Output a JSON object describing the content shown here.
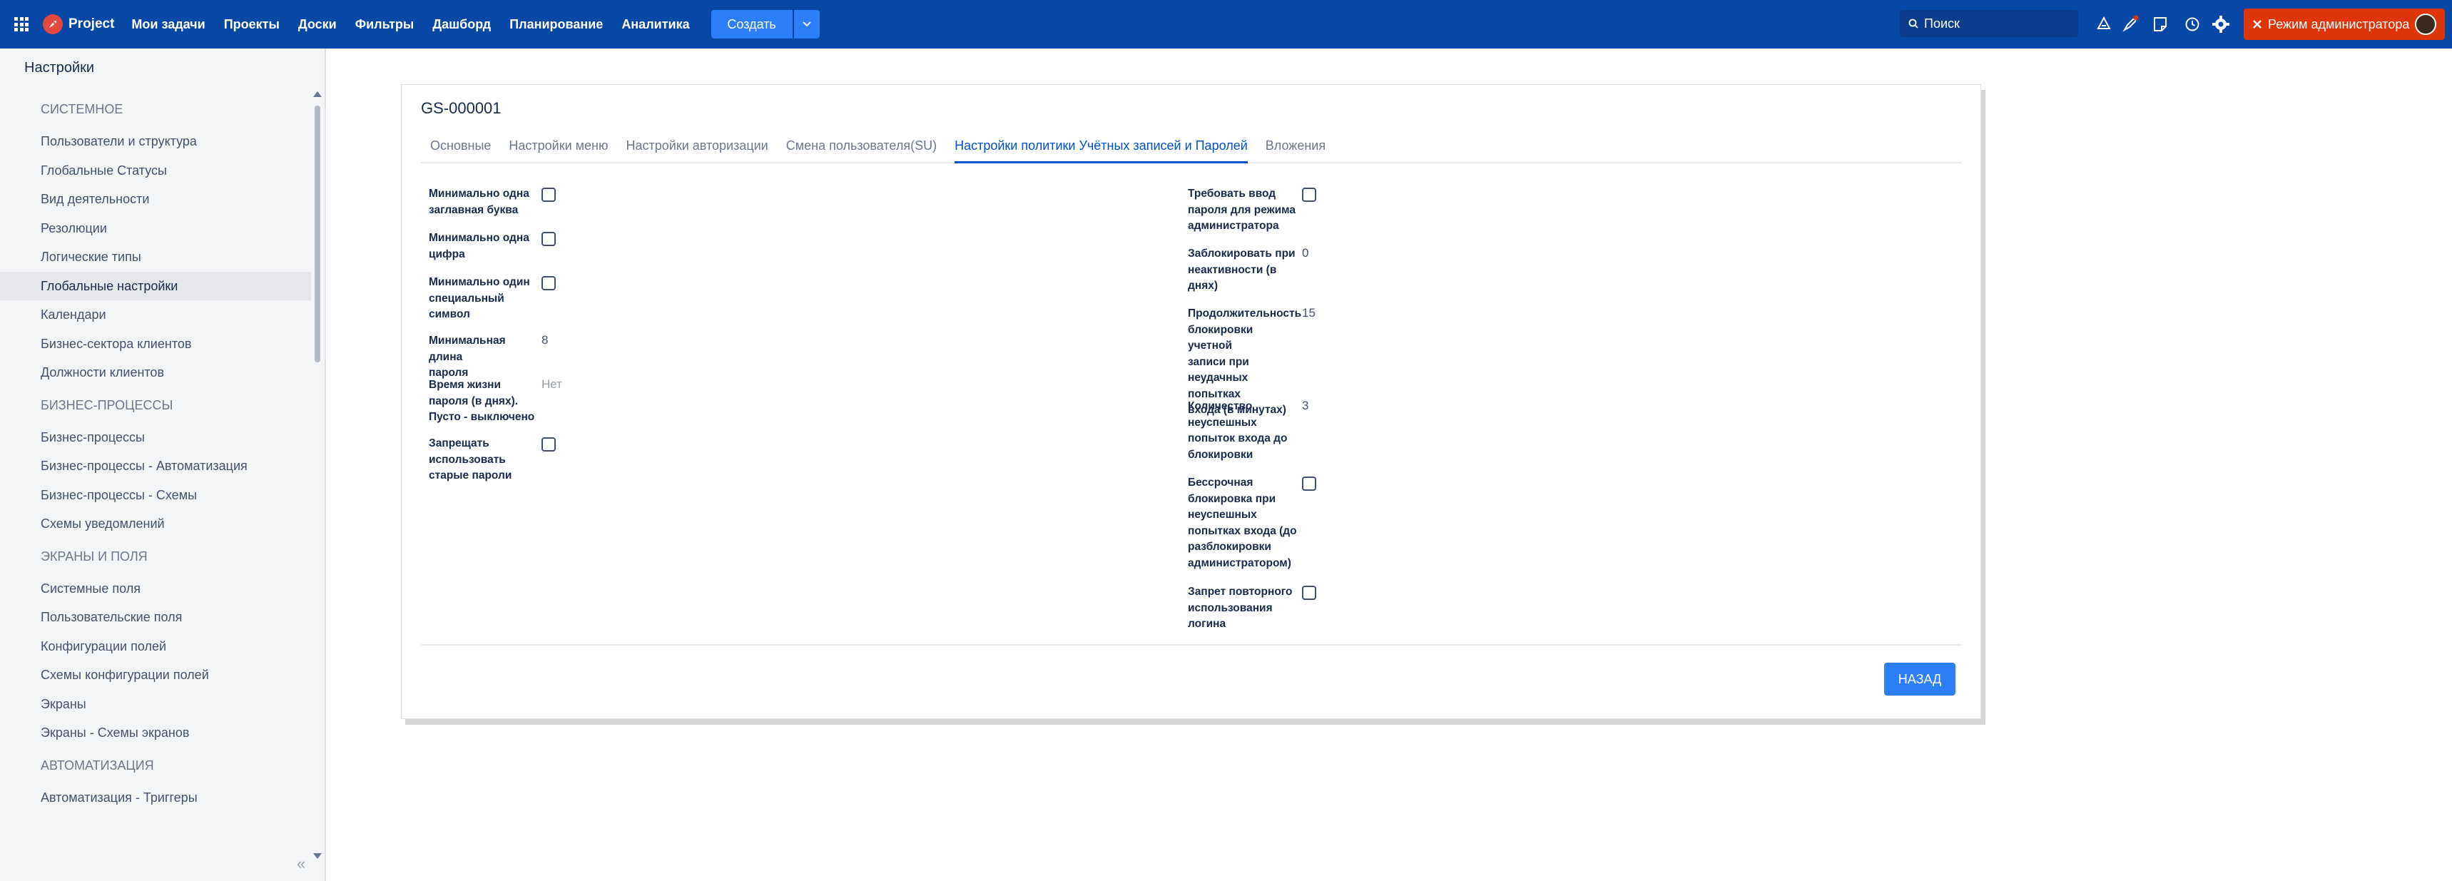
{
  "header": {
    "app_name": "Project",
    "nav": [
      "Мои задачи",
      "Проекты",
      "Доски",
      "Фильтры",
      "Дашборд",
      "Планирование",
      "Аналитика"
    ],
    "create_label": "Создать",
    "search_placeholder": "Поиск",
    "admin_label": "Режим администратора"
  },
  "sidebar": {
    "title": "Настройки",
    "entries": [
      {
        "type": "section",
        "label": "СИСТЕМНОЕ"
      },
      {
        "type": "item",
        "label": "Пользователи и структура"
      },
      {
        "type": "item",
        "label": "Глобальные Статусы"
      },
      {
        "type": "item",
        "label": "Вид деятельности"
      },
      {
        "type": "item",
        "label": "Резолюции"
      },
      {
        "type": "item",
        "label": "Логические типы"
      },
      {
        "type": "item",
        "label": "Глобальные настройки",
        "active": true
      },
      {
        "type": "item",
        "label": "Календари"
      },
      {
        "type": "item",
        "label": "Бизнес-сектора клиентов"
      },
      {
        "type": "item",
        "label": "Должности клиентов"
      },
      {
        "type": "section",
        "label": "БИЗНЕС-ПРОЦЕССЫ"
      },
      {
        "type": "item",
        "label": "Бизнес-процессы"
      },
      {
        "type": "item",
        "label": "Бизнес-процессы - Автоматизация"
      },
      {
        "type": "item",
        "label": "Бизнес-процессы - Схемы"
      },
      {
        "type": "item",
        "label": "Схемы уведомлений"
      },
      {
        "type": "section",
        "label": "ЭКРАНЫ И ПОЛЯ"
      },
      {
        "type": "item",
        "label": "Системные поля"
      },
      {
        "type": "item",
        "label": "Пользовательские поля"
      },
      {
        "type": "item",
        "label": "Конфигурации полей"
      },
      {
        "type": "item",
        "label": "Схемы конфигурации полей"
      },
      {
        "type": "item",
        "label": "Экраны"
      },
      {
        "type": "item",
        "label": "Экраны - Схемы экранов"
      },
      {
        "type": "section",
        "label": "АВТОМАТИЗАЦИЯ"
      },
      {
        "type": "item",
        "label": "Автоматизация - Триггеры"
      }
    ]
  },
  "main": {
    "title": "GS-000001",
    "tabs": [
      {
        "label": "Основные"
      },
      {
        "label": "Настройки меню"
      },
      {
        "label": "Настройки авторизации"
      },
      {
        "label": "Смена пользователя(SU)"
      },
      {
        "label": "Настройки политики Учётных записей и Паролей",
        "active": true
      },
      {
        "label": "Вложения"
      }
    ],
    "left_fields": [
      {
        "lines": [
          "Минимально одна",
          "заглавная буква"
        ],
        "type": "checkbox",
        "checked": false
      },
      {
        "lines": [
          "Минимально одна",
          "цифра"
        ],
        "type": "checkbox",
        "checked": false
      },
      {
        "lines": [
          "Минимально один",
          "специальный",
          "символ"
        ],
        "type": "checkbox",
        "checked": false
      },
      {
        "lines": [
          "Минимальная длина",
          "пароля"
        ],
        "type": "text",
        "value": "8"
      },
      {
        "lines": [
          "Время жизни",
          "пароля (в днях).",
          "Пусто - выключено"
        ],
        "type": "text",
        "value": "Нет",
        "muted": true
      },
      {
        "lines": [
          "Запрещать",
          "использовать",
          "старые пароли"
        ],
        "type": "checkbox",
        "checked": false
      }
    ],
    "right_fields": [
      {
        "lines": [
          "Требовать ввод",
          "пароля для режима",
          "администратора"
        ],
        "type": "checkbox",
        "checked": false
      },
      {
        "lines": [
          "Заблокировать при",
          "неактивности (в",
          "днях)"
        ],
        "type": "text",
        "value": "0"
      },
      {
        "lines": [
          "Продолжительность",
          "блокировки учетной",
          "записи при",
          "неудачных попытках",
          "входа (в минутах)"
        ],
        "type": "text",
        "value": "15"
      },
      {
        "lines": [
          "Количество",
          "неуспешных",
          "попыток входа до",
          "блокировки"
        ],
        "type": "text",
        "value": "3"
      },
      {
        "lines": [
          "Бессрочная",
          "блокировка при",
          "неуспешных",
          "попытках входа (до",
          "разблокировки",
          "администратором)"
        ],
        "type": "checkbox",
        "checked": false
      },
      {
        "lines": [
          "Запрет повторного",
          "использования",
          "логина"
        ],
        "type": "checkbox",
        "checked": false
      }
    ],
    "back_label": "НАЗАД"
  },
  "colors": {
    "header_bg": "#0747a6",
    "accent": "#2d7ff9",
    "admin": "#de350b",
    "active_tab": "#0052cc"
  }
}
